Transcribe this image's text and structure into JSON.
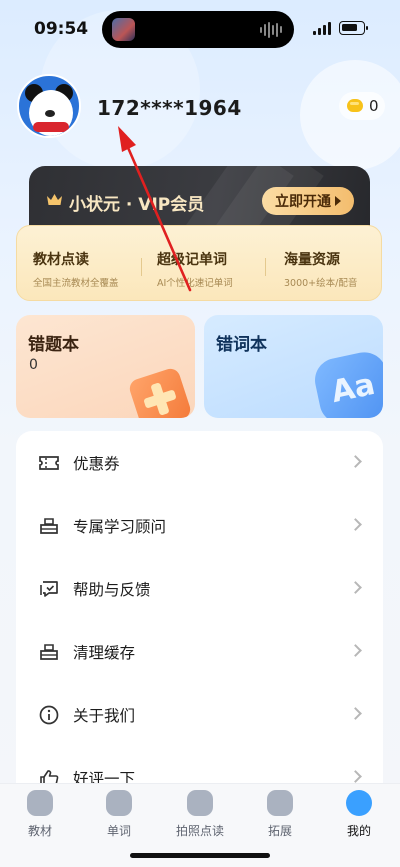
{
  "status_bar": {
    "time": "09:54"
  },
  "profile": {
    "phone": "172****1964",
    "coin_count": "0"
  },
  "vip": {
    "title": "小状元 · VIP会员",
    "button_label": "立即开通",
    "benefits": [
      {
        "title": "教材点读",
        "subtitle": "全国主流教材全覆盖"
      },
      {
        "title": "超级记单词",
        "subtitle": "AI个性化速记单词"
      },
      {
        "title": "海量资源",
        "subtitle": "3000+绘本/配音"
      }
    ]
  },
  "cards": {
    "mistakes": {
      "title": "错题本",
      "count": "0"
    },
    "words": {
      "title": "错词本",
      "icon_text": "Aa"
    }
  },
  "menu": [
    {
      "label": "优惠券",
      "icon": "coupon-icon"
    },
    {
      "label": "专属学习顾问",
      "icon": "advisor-icon"
    },
    {
      "label": "帮助与反馈",
      "icon": "feedback-icon"
    },
    {
      "label": "清理缓存",
      "icon": "clean-icon"
    },
    {
      "label": "关于我们",
      "icon": "info-icon"
    },
    {
      "label": "好评一下",
      "icon": "thumbs-up-icon"
    }
  ],
  "tabs": [
    {
      "label": "教材",
      "icon": "textbook-icon"
    },
    {
      "label": "单词",
      "icon": "words-icon"
    },
    {
      "label": "拍照点读",
      "icon": "camera-icon"
    },
    {
      "label": "拓展",
      "icon": "expand-icon"
    },
    {
      "label": "我的",
      "icon": "profile-icon",
      "active": true
    }
  ],
  "colors": {
    "accent": "#3aa0ff",
    "vip_gold": "#f3bd6e",
    "annotation_arrow": "#e02020"
  }
}
